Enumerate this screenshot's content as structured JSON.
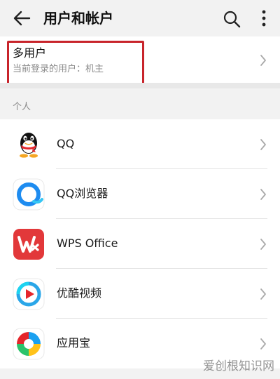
{
  "header": {
    "title": "用户和帐户",
    "back_icon": "back-arrow-icon",
    "search_icon": "search-icon",
    "more_icon": "more-vertical-icon"
  },
  "multi_user": {
    "title": "多用户",
    "subtitle": "当前登录的用户：机主",
    "highlight_color": "#c8242b"
  },
  "section": {
    "label": "个人"
  },
  "accounts": [
    {
      "label": "QQ",
      "icon": "qq-icon"
    },
    {
      "label": "QQ浏览器",
      "icon": "qq-browser-icon"
    },
    {
      "label": "WPS Office",
      "icon": "wps-office-icon"
    },
    {
      "label": "优酷视频",
      "icon": "youku-icon"
    },
    {
      "label": "应用宝",
      "icon": "yingyongbao-icon"
    }
  ],
  "watermark": "爱创根知识网",
  "colors": {
    "background": "#f2f2f2",
    "card": "#ffffff",
    "wps_red": "#e2383a",
    "youku_blue": "#2aa6e8"
  }
}
